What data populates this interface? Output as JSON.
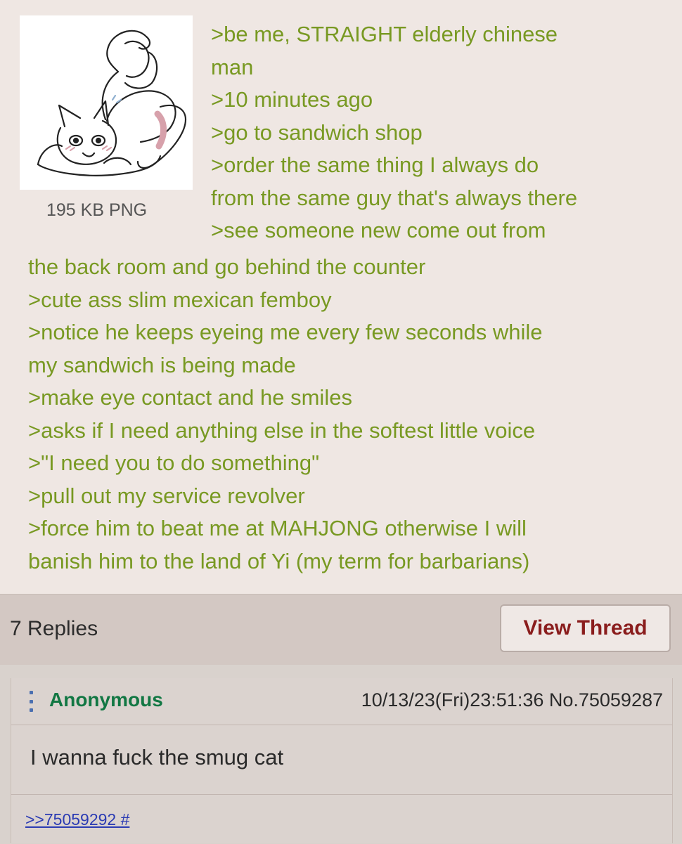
{
  "op": {
    "file_info": "195 KB PNG",
    "thumbnail_icon": "smug-cat-drawing",
    "greentext_top": [
      ">be me, STRAIGHT elderly chinese",
      "man",
      ">10 minutes ago",
      ">go to sandwich shop",
      ">order the same thing I always do",
      "from the same guy that's always there",
      ">see someone new come out from"
    ],
    "greentext_full": [
      "the back room and go behind the counter",
      ">cute ass slim mexican femboy",
      ">notice he keeps eyeing me every few seconds while",
      "my sandwich is being made",
      ">make eye contact and he smiles",
      ">asks if I need anything else in the softest little voice",
      ">\"I need you to do something\"",
      ">pull out my service revolver",
      ">force him to beat me at MAHJONG otherwise I will",
      "banish him to the land of Yi (my term for barbarians)"
    ]
  },
  "thread": {
    "replies": "7 Replies",
    "view_thread": "View Thread"
  },
  "reply": {
    "name": "Anonymous",
    "datetime": "10/13/23(Fri)23:51:36 No.75059287",
    "body": "I wanna fuck the smug cat",
    "backlink": ">>75059292 #"
  },
  "colors": {
    "greentext": "#789922",
    "name": "#117743",
    "view_thread_text": "#8a1d1d",
    "link": "#2b3bb3"
  }
}
